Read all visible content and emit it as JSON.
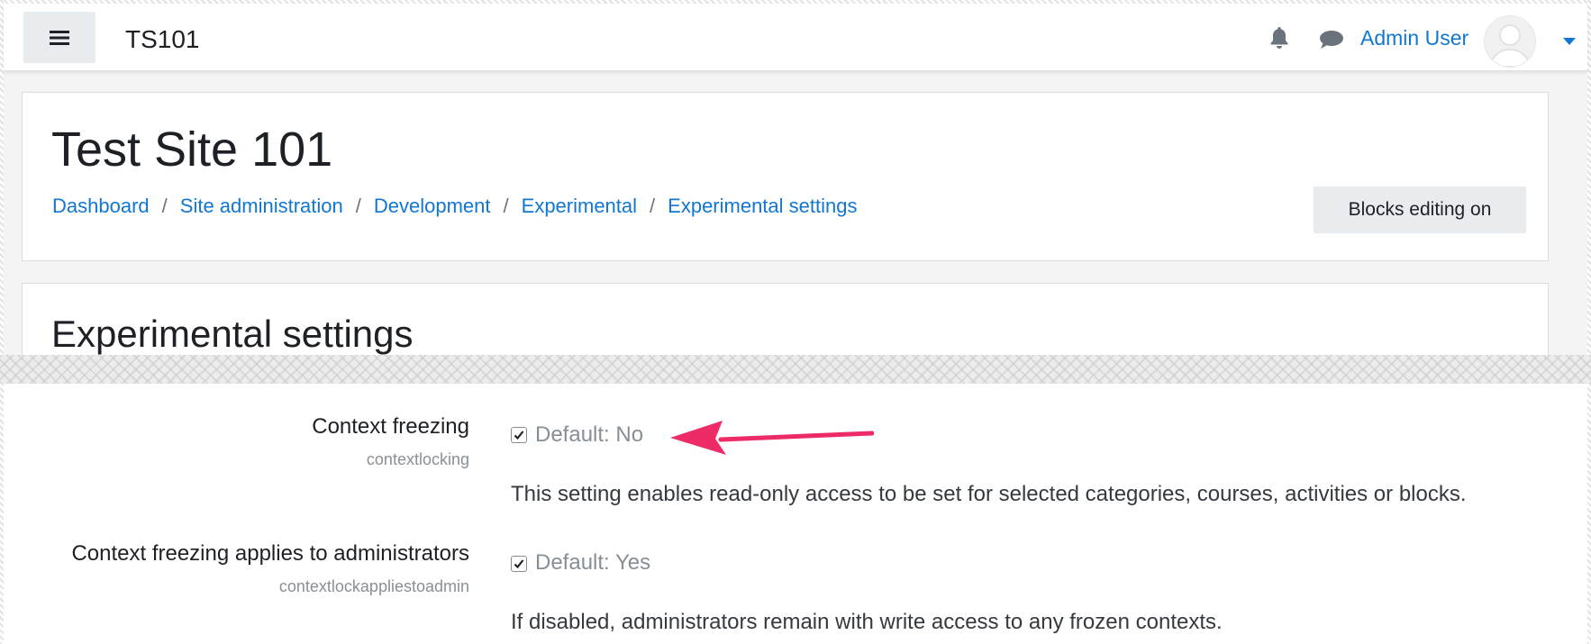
{
  "navbar": {
    "site_shortname": "TS101",
    "user_name": "Admin User"
  },
  "header": {
    "title": "Test Site 101",
    "breadcrumb": [
      "Dashboard",
      "Site administration",
      "Development",
      "Experimental",
      "Experimental settings"
    ],
    "blocks_button": "Blocks editing on"
  },
  "main": {
    "title": "Experimental settings"
  },
  "settings": [
    {
      "label": "Context freezing",
      "key": "contextlocking",
      "checked": true,
      "default": "Default: No",
      "description": "This setting enables read-only access to be set for selected categories, courses, activities or blocks."
    },
    {
      "label": "Context freezing applies to administrators",
      "key": "contextlockappliestoadmin",
      "checked": true,
      "default": "Default: Yes",
      "description": "If disabled, administrators remain with write access to any frozen contexts."
    }
  ],
  "colors": {
    "link": "#1177d1",
    "annotation_arrow": "#ec2b67",
    "button_bg": "#e9ecef"
  },
  "icons": [
    "hamburger-icon",
    "bell-icon",
    "chat-icon",
    "avatar",
    "caret-down-icon",
    "checkbox-checked-icon",
    "annotation-arrow"
  ]
}
